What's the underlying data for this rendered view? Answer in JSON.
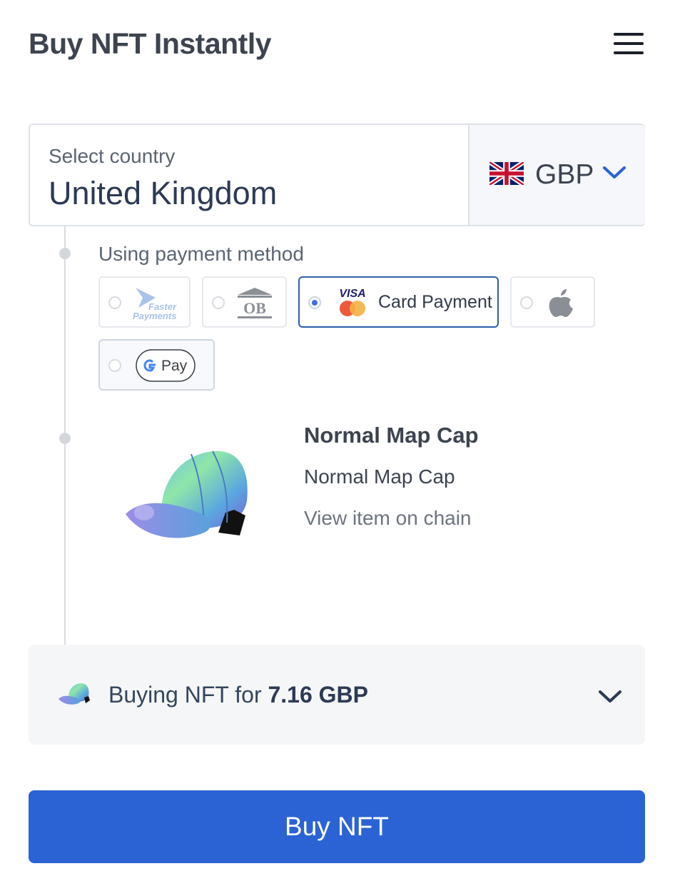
{
  "header": {
    "title": "Buy NFT Instantly",
    "menu_icon": "hamburger-menu-icon"
  },
  "country": {
    "label": "Select country",
    "value": "United Kingdom"
  },
  "currency": {
    "code": "GBP",
    "flag_icon": "uk-flag-icon"
  },
  "payment": {
    "label": "Using payment method",
    "methods": [
      {
        "id": "faster-payments",
        "logo_text_1": "Faster",
        "logo_text_2": "Payments",
        "selected": false
      },
      {
        "id": "open-banking",
        "logo_text": "OB",
        "selected": false
      },
      {
        "id": "card",
        "logo_text": "VISA",
        "label": "Card Payment",
        "selected": true
      },
      {
        "id": "apple-pay",
        "icon": "apple-icon",
        "selected": false
      },
      {
        "id": "google-pay",
        "logo_text": "Pay",
        "selected": false
      }
    ]
  },
  "nft": {
    "name": "Normal Map Cap",
    "subtitle": "Normal Map Cap",
    "link": "View item on chain"
  },
  "summary": {
    "prefix": "Buying NFT for",
    "amount": "7.16 GBP"
  },
  "buy_button": {
    "label": "Buy NFT"
  },
  "colors": {
    "accent": "#2b63d4",
    "selected_border": "#2e5fa8",
    "summary_bg": "#f5f6f7"
  }
}
